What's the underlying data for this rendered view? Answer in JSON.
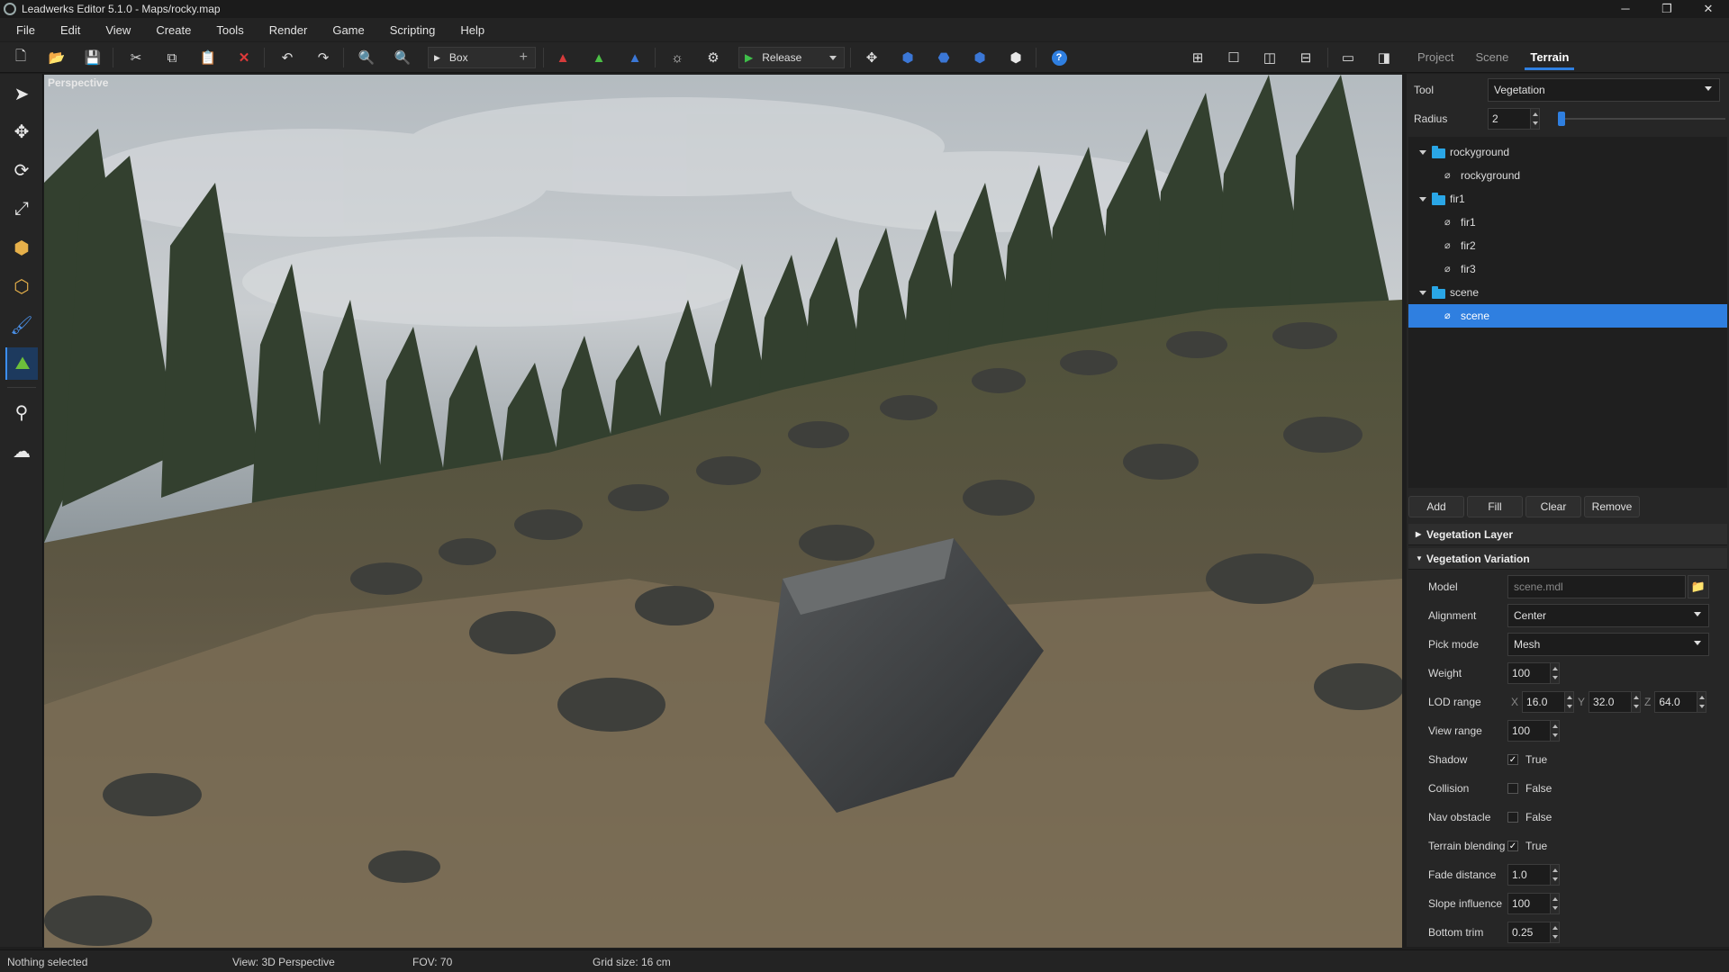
{
  "window": {
    "title": "Leadwerks Editor 5.1.0 - Maps/rocky.map",
    "min_icon": "minimize-icon",
    "max_icon": "restore-icon",
    "close_icon": "close-icon"
  },
  "menu": [
    "File",
    "Edit",
    "View",
    "Create",
    "Tools",
    "Render",
    "Game",
    "Scripting",
    "Help"
  ],
  "toolbar": {
    "primitive_combo": "Box",
    "build_combo": "Release",
    "icons": [
      "new-map-icon",
      "open-icon",
      "save-icon",
      "cut-icon",
      "copy-icon",
      "paste-icon",
      "delete-icon",
      "undo-icon",
      "redo-icon",
      "zoom-in-icon",
      "zoom-out-icon",
      "add-icon",
      "red-mountain-icon",
      "green-mountain-icon",
      "blue-mountain-icon",
      "settings-icon",
      "options-icon",
      "play-icon",
      "move-gizmo-icon",
      "blue-cube-icon",
      "blue-sphere-icon",
      "blue-box-icon",
      "white-box-icon",
      "help-icon",
      "grid-four-icon",
      "single-view-icon",
      "split-vertical-icon",
      "split-horizontal-icon",
      "panel-bottom-icon",
      "panel-right-icon"
    ]
  },
  "tabs": {
    "project": "Project",
    "scene": "Scene",
    "terrain": "Terrain",
    "active": "Terrain"
  },
  "terrain": {
    "tool_label": "Tool",
    "tool_value": "Vegetation",
    "radius_label": "Radius",
    "radius_value": "2",
    "tree": [
      {
        "label": "rockyground",
        "type": "folder"
      },
      {
        "label": "rockyground",
        "type": "item"
      },
      {
        "label": "fir1",
        "type": "folder"
      },
      {
        "label": "fir1",
        "type": "item"
      },
      {
        "label": "fir2",
        "type": "item"
      },
      {
        "label": "fir3",
        "type": "item"
      },
      {
        "label": "scene",
        "type": "folder"
      },
      {
        "label": "scene",
        "type": "item",
        "selected": true
      }
    ],
    "buttons": {
      "add": "Add",
      "fill": "Fill",
      "clear": "Clear",
      "remove": "Remove"
    },
    "sections": {
      "layer": "Vegetation Layer",
      "variation": "Vegetation Variation"
    },
    "props": {
      "model_label": "Model",
      "model_value": "scene.mdl",
      "alignment_label": "Alignment",
      "alignment_value": "Center",
      "pickmode_label": "Pick mode",
      "pickmode_value": "Mesh",
      "weight_label": "Weight",
      "weight_value": "100",
      "lod_label": "LOD range",
      "lod_x": "16.0",
      "lod_y": "32.0",
      "lod_z": "64.0",
      "lod_x_axis": "X",
      "lod_y_axis": "Y",
      "lod_z_axis": "Z",
      "viewrange_label": "View range",
      "viewrange_value": "100",
      "shadow_label": "Shadow",
      "shadow_value": "True",
      "collision_label": "Collision",
      "collision_value": "False",
      "nav_label": "Nav obstacle",
      "nav_value": "False",
      "blend_label": "Terrain blending",
      "blend_value": "True",
      "fade_label": "Fade distance",
      "fade_value": "1.0",
      "slope_label": "Slope influence",
      "slope_value": "100",
      "trim_label": "Bottom trim",
      "trim_value": "0.25"
    }
  },
  "viewport": {
    "label": "Perspective"
  },
  "status": {
    "selection": "Nothing selected",
    "view": "View: 3D Perspective",
    "fov": "FOV: 70",
    "grid": "Grid size: 16 cm"
  },
  "colors": {
    "accent": "#2f7fe0",
    "folder": "#2aa6e6"
  }
}
